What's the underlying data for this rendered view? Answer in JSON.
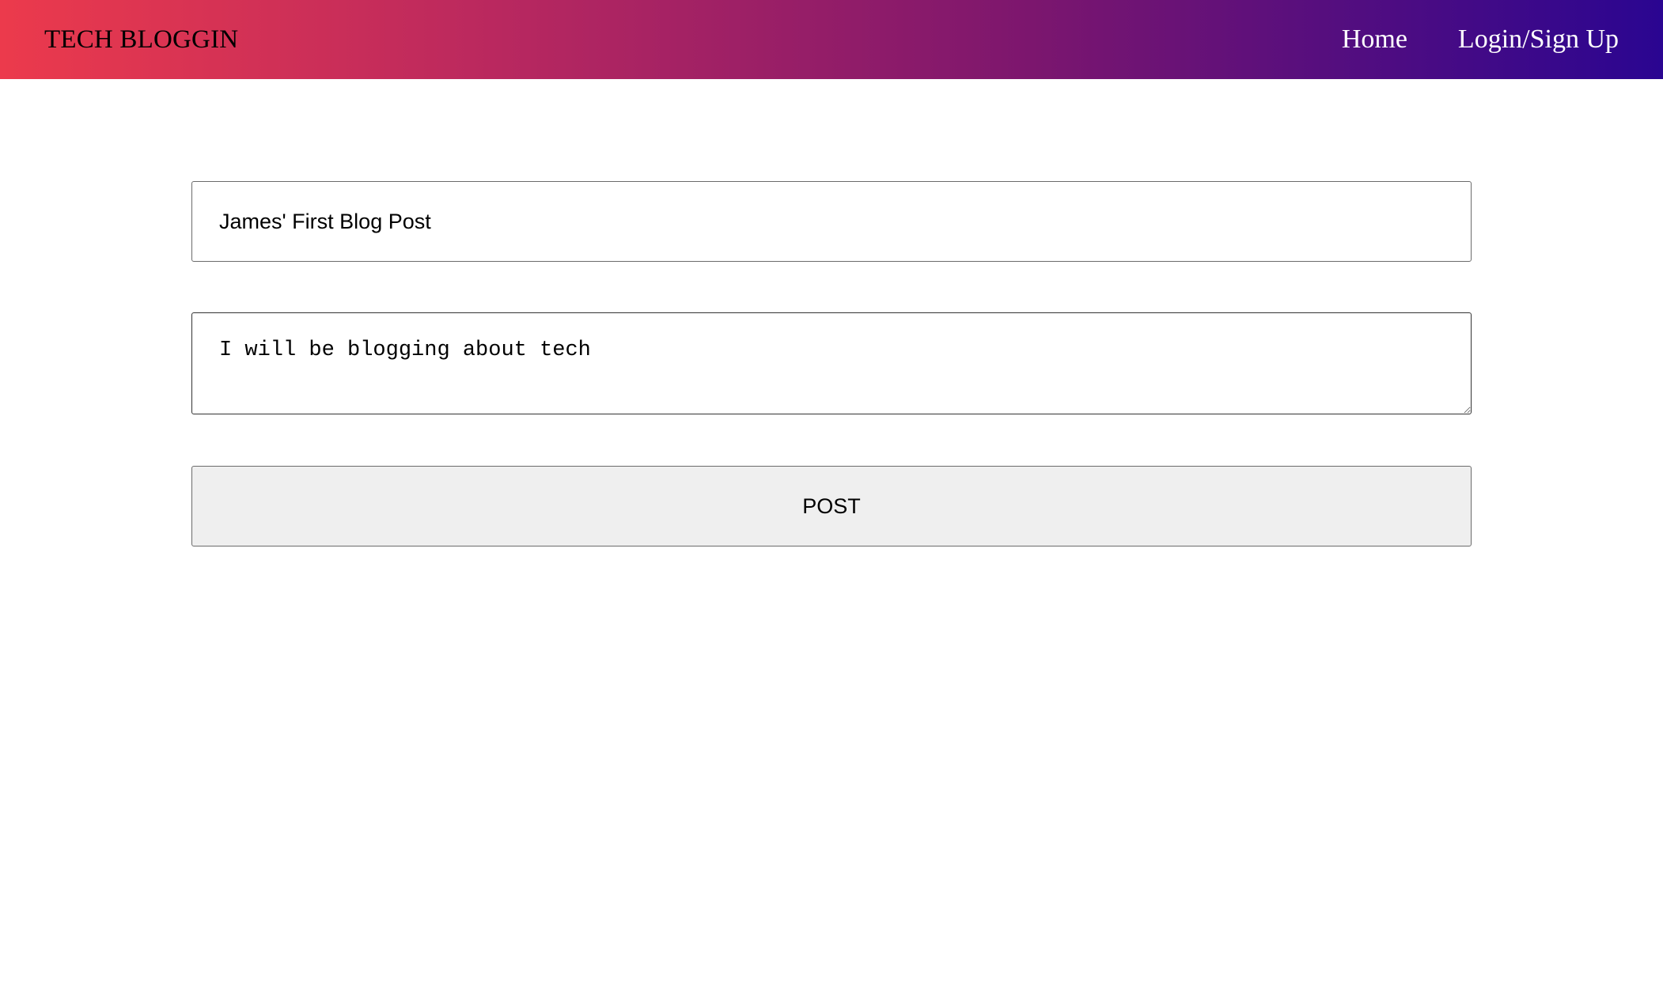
{
  "navbar": {
    "brand": "TECH BLOGGIN",
    "links": [
      {
        "label": "Home"
      },
      {
        "label": "Login/Sign Up"
      }
    ],
    "gradient_colors": [
      "#ec3a4c",
      "#2a0591"
    ]
  },
  "post_form": {
    "title_value": "James' First Blog Post",
    "body_value": "I will be blogging about tech",
    "submit_label": "POST"
  }
}
